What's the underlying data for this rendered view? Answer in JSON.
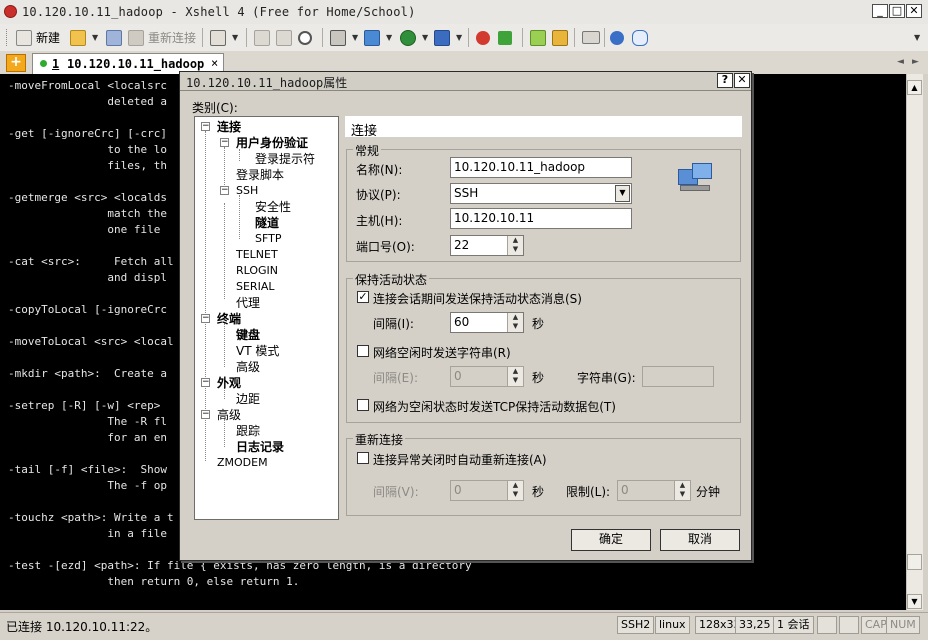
{
  "window": {
    "title": "10.120.10.11_hadoop - Xshell 4 (Free for Home/School)",
    "min_glyph": "_",
    "max_glyph": "□",
    "close_glyph": "✕"
  },
  "toolbar": {
    "new_label": "新建",
    "reconnect_label": "重新连接"
  },
  "tabs": [
    {
      "index": "1",
      "label": "10.120.10.11_hadoop",
      "close_glyph": "×"
    }
  ],
  "tab_scroll": {
    "left": "◄",
    "right": "►"
  },
  "terminal": {
    "lines": [
      "-moveFromLocal <localsrc",
      "               deleted a",
      "",
      "-get [-ignoreCrc] [-crc]",
      "               to the lo",
      "               files, th",
      "",
      "-getmerge <src> <localds",
      "               match the",
      "               one file ",
      "",
      "-cat <src>:     Fetch all",
      "               and displ",
      "",
      "-copyToLocal [-ignoreCrc",
      "",
      "-moveToLocal <src> <local",
      "",
      "-mkdir <path>:  Create a",
      "",
      "-setrep [-R] [-w] <rep> ",
      "               The -R fl",
      "               for an en",
      "",
      "-tail [-f] <file>:  Show",
      "               The -f op",
      "",
      "-touchz <path>: Write a t",
      "               in a file",
      "",
      "-test -[ezd] <path>: If file { exists, has zero length, is a directory",
      "               then return 0, else return 1."
    ]
  },
  "statusbar": {
    "connection": "已连接 10.120.10.11:22。",
    "protocol": "SSH2",
    "term": "linux",
    "size": "128x33",
    "cursor": "33,25",
    "sessions": "1 会话",
    "cap": "CAP",
    "num": "NUM"
  },
  "dialog": {
    "title": "10.120.10.11_hadoop属性",
    "help_glyph": "?",
    "close_glyph": "✕",
    "category_label": "类别(C):",
    "tree": {
      "connection": "连接",
      "auth": "用户身份验证",
      "login_prompt": "登录提示符",
      "login_script": "登录脚本",
      "ssh": "SSH",
      "security": "安全性",
      "tunnel": "隧道",
      "sftp": "SFTP",
      "telnet": "TELNET",
      "rlogin": "RLOGIN",
      "serial": "SERIAL",
      "proxy": "代理",
      "terminal": "终端",
      "keyboard": "键盘",
      "vt_mode": "VT 模式",
      "advanced": "高级",
      "appearance": "外观",
      "margin": "边距",
      "advanced2": "高级",
      "trace": "跟踪",
      "log": "日志记录",
      "zmodem": "ZMODEM"
    },
    "panel_header": "连接",
    "general": {
      "group": "常规",
      "name_label": "名称(N):",
      "name_value": "10.120.10.11_hadoop",
      "protocol_label": "协议(P):",
      "protocol_value": "SSH",
      "host_label": "主机(H):",
      "host_value": "10.120.10.11",
      "port_label": "端口号(O):",
      "port_value": "22"
    },
    "keepalive": {
      "group": "保持活动状态",
      "send_keepalive": "连接会话期间发送保持活动状态消息(S)",
      "send_keepalive_checked": true,
      "interval_label": "间隔(I):",
      "interval_value": "60",
      "seconds": "秒",
      "send_string": "网络空闲时发送字符串(R)",
      "interval_e_label": "间隔(E):",
      "interval_e_value": "0",
      "seconds2": "秒",
      "string_label": "字符串(G):",
      "tcp_keepalive": "网络为空闲状态时发送TCP保持活动数据包(T)"
    },
    "reconnect": {
      "group": "重新连接",
      "auto_reconnect": "连接异常关闭时自动重新连接(A)",
      "interval_label": "间隔(V):",
      "interval_value": "0",
      "seconds": "秒",
      "limit_label": "限制(L):",
      "limit_value": "0",
      "minutes": "分钟"
    },
    "ok_label": "确定",
    "cancel_label": "取消"
  }
}
